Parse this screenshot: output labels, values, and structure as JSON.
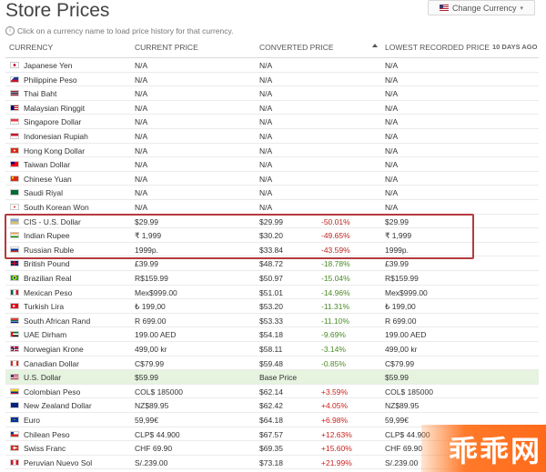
{
  "page": {
    "title": "Store Prices",
    "hint": "Click on a currency name to load price history for that currency."
  },
  "change_currency": {
    "label": "Change Currency"
  },
  "columns": {
    "currency": "CURRENCY",
    "current_price": "CURRENT PRICE",
    "converted_price": "CONVERTED PRICE",
    "lowest": "LOWEST RECORDED PRICE",
    "days_ago": "10 DAYS AGO"
  },
  "rows": [
    {
      "name": "Japanese Yen",
      "current": "N/A",
      "converted": "N/A",
      "pct": "",
      "lowest": "N/A",
      "flag": "jp"
    },
    {
      "name": "Philippine Peso",
      "current": "N/A",
      "converted": "N/A",
      "pct": "",
      "lowest": "N/A",
      "flag": "ph"
    },
    {
      "name": "Thai Baht",
      "current": "N/A",
      "converted": "N/A",
      "pct": "",
      "lowest": "N/A",
      "flag": "th"
    },
    {
      "name": "Malaysian Ringgit",
      "current": "N/A",
      "converted": "N/A",
      "pct": "",
      "lowest": "N/A",
      "flag": "my"
    },
    {
      "name": "Singapore Dollar",
      "current": "N/A",
      "converted": "N/A",
      "pct": "",
      "lowest": "N/A",
      "flag": "sg"
    },
    {
      "name": "Indonesian Rupiah",
      "current": "N/A",
      "converted": "N/A",
      "pct": "",
      "lowest": "N/A",
      "flag": "id"
    },
    {
      "name": "Hong Kong Dollar",
      "current": "N/A",
      "converted": "N/A",
      "pct": "",
      "lowest": "N/A",
      "flag": "hk"
    },
    {
      "name": "Taiwan Dollar",
      "current": "N/A",
      "converted": "N/A",
      "pct": "",
      "lowest": "N/A",
      "flag": "tw"
    },
    {
      "name": "Chinese Yuan",
      "current": "N/A",
      "converted": "N/A",
      "pct": "",
      "lowest": "N/A",
      "flag": "cn"
    },
    {
      "name": "Saudi Riyal",
      "current": "N/A",
      "converted": "N/A",
      "pct": "",
      "lowest": "N/A",
      "flag": "sa"
    },
    {
      "name": "South Korean Won",
      "current": "N/A",
      "converted": "N/A",
      "pct": "",
      "lowest": "N/A",
      "flag": "kr"
    },
    {
      "name": "CIS - U.S. Dollar",
      "current": "$29.99",
      "converted": "$29.99",
      "pct": "-50.01%",
      "lowest": "$29.99",
      "flag": "cis"
    },
    {
      "name": "Indian Rupee",
      "current": "₹ 1,999",
      "converted": "$30.20",
      "pct": "-49.65%",
      "lowest": "₹ 1,999",
      "flag": "in"
    },
    {
      "name": "Russian Ruble",
      "current": "1999p.",
      "converted": "$33.84",
      "pct": "-43.59%",
      "lowest": "1999p.",
      "flag": "ru"
    },
    {
      "name": "British Pound",
      "current": "£39.99",
      "converted": "$48.72",
      "pct": "-18.78%",
      "lowest": "£39.99",
      "flag": "gb"
    },
    {
      "name": "Brazilian Real",
      "current": "R$159.99",
      "converted": "$50.97",
      "pct": "-15.04%",
      "lowest": "R$159.99",
      "flag": "br"
    },
    {
      "name": "Mexican Peso",
      "current": "Mex$999.00",
      "converted": "$51.01",
      "pct": "-14.96%",
      "lowest": "Mex$999.00",
      "flag": "mx"
    },
    {
      "name": "Turkish Lira",
      "current": "₺ 199,00",
      "converted": "$53.20",
      "pct": "-11.31%",
      "lowest": "₺ 199,00",
      "flag": "tr"
    },
    {
      "name": "South African Rand",
      "current": "R 699.00",
      "converted": "$53.33",
      "pct": "-11.10%",
      "lowest": "R 699.00",
      "flag": "za"
    },
    {
      "name": "UAE Dirham",
      "current": "199.00 AED",
      "converted": "$54.18",
      "pct": "-9.69%",
      "lowest": "199.00 AED",
      "flag": "ae"
    },
    {
      "name": "Norwegian Krone",
      "current": "499,00 kr",
      "converted": "$58.11",
      "pct": "-3.14%",
      "lowest": "499,00 kr",
      "flag": "no"
    },
    {
      "name": "Canadian Dollar",
      "current": "C$79.99",
      "converted": "$59.48",
      "pct": "-0.85%",
      "lowest": "C$79.99",
      "flag": "ca"
    },
    {
      "name": "U.S. Dollar",
      "current": "$59.99",
      "converted": "Base Price",
      "pct": "",
      "lowest": "$59.99",
      "flag": "us",
      "base": true
    },
    {
      "name": "Colombian Peso",
      "current": "COL$ 185000",
      "converted": "$62.14",
      "pct": "+3.59%",
      "lowest": "COL$ 185000",
      "flag": "co"
    },
    {
      "name": "New Zealand Dollar",
      "current": "NZ$89.95",
      "converted": "$62.42",
      "pct": "+4.05%",
      "lowest": "NZ$89.95",
      "flag": "nz"
    },
    {
      "name": "Euro",
      "current": "59,99€",
      "converted": "$64.18",
      "pct": "+6.98%",
      "lowest": "59,99€",
      "flag": "eu"
    },
    {
      "name": "Chilean Peso",
      "current": "CLP$ 44.900",
      "converted": "$67.57",
      "pct": "+12.63%",
      "lowest": "CLP$ 44.900",
      "flag": "cl"
    },
    {
      "name": "Swiss Franc",
      "current": "CHF 69.90",
      "converted": "$69.35",
      "pct": "+15.60%",
      "lowest": "CHF 69.90",
      "flag": "ch"
    },
    {
      "name": "Peruvian Nuevo Sol",
      "current": "S/.239.00",
      "converted": "$73.18",
      "pct": "+21.99%",
      "lowest": "S/.239.00",
      "flag": "pe"
    }
  ],
  "watermark": {
    "text": "乖乖网"
  }
}
